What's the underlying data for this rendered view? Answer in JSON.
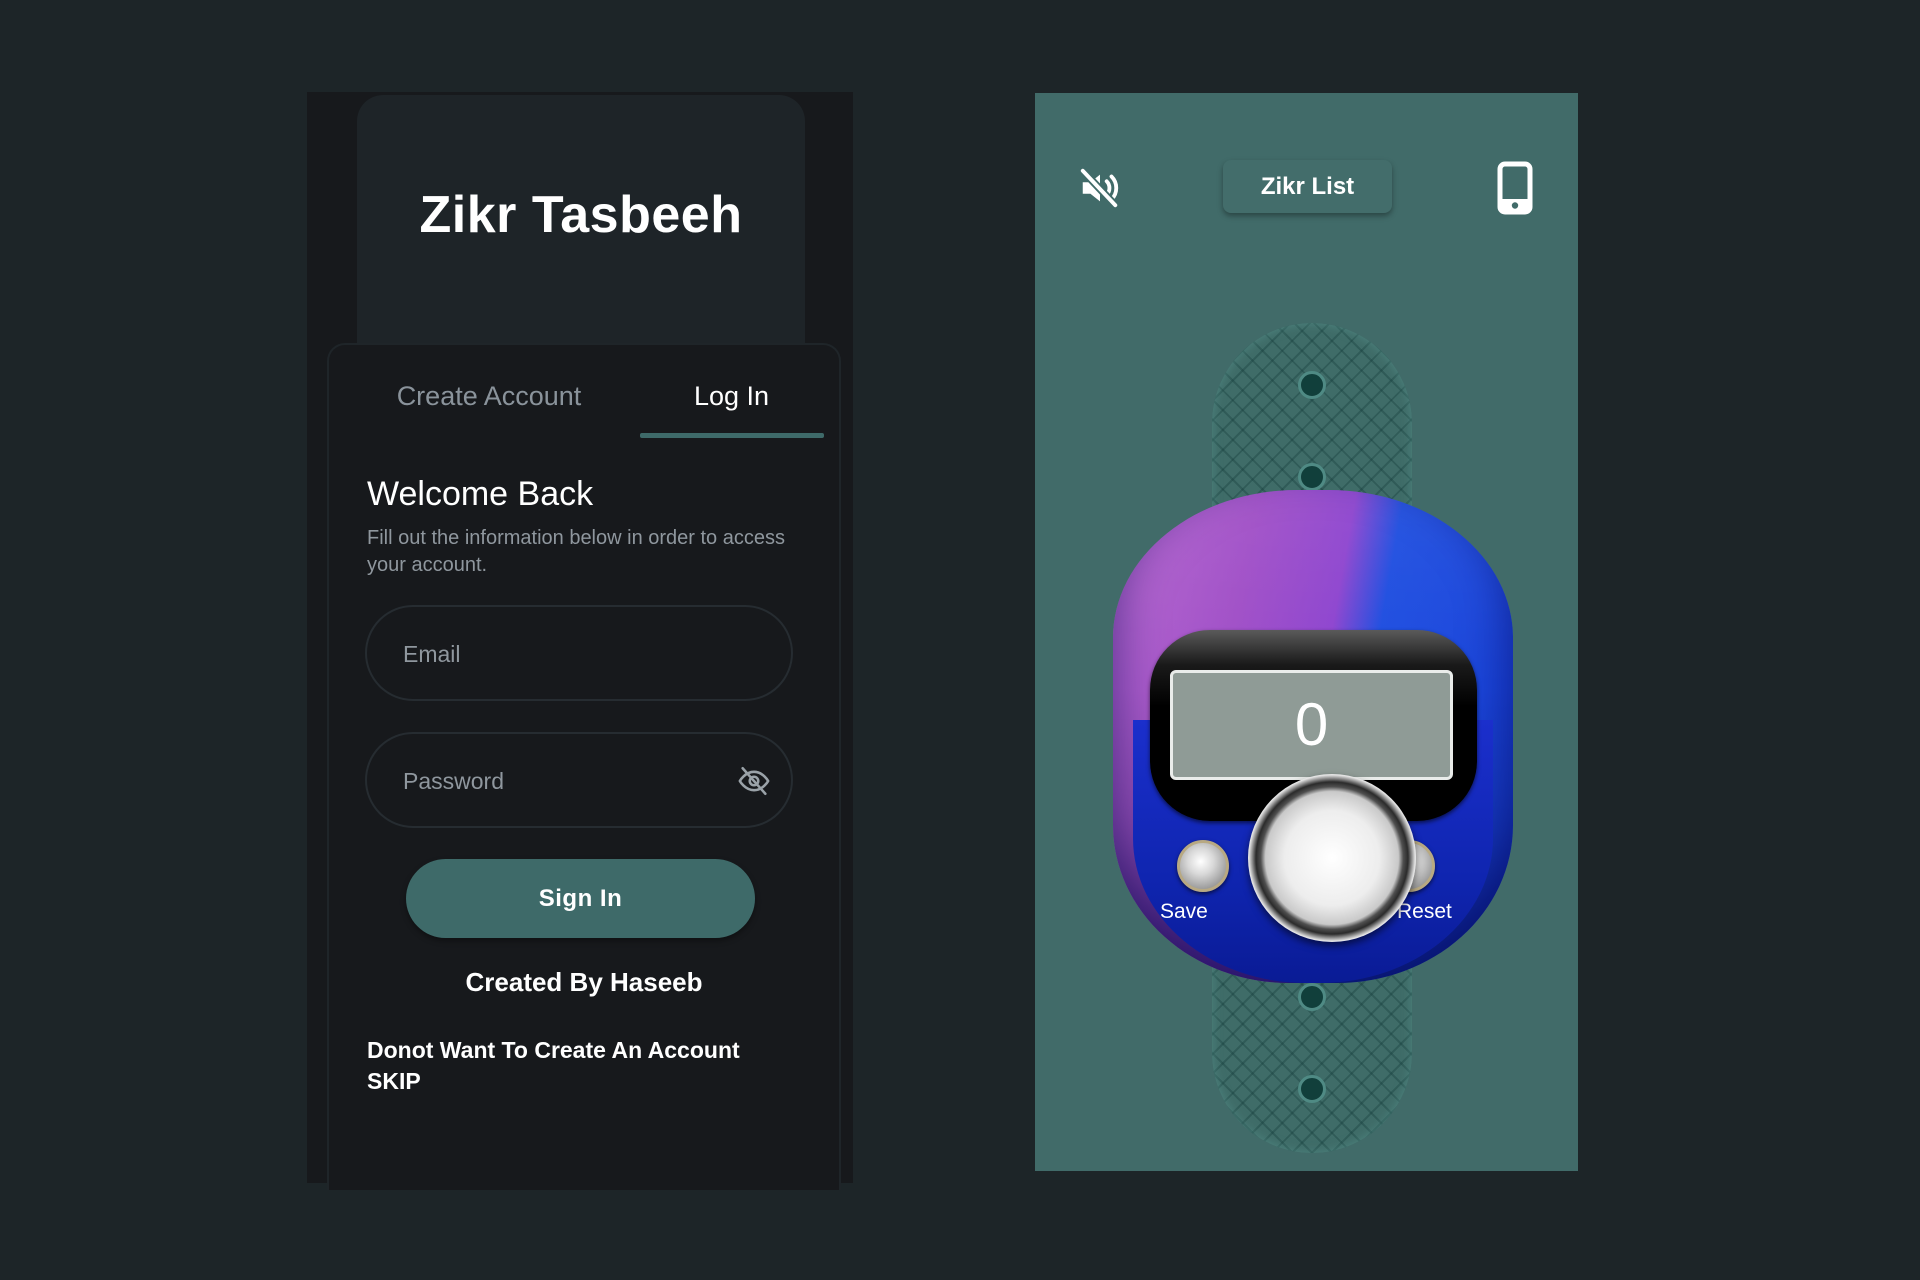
{
  "login_screen": {
    "app_title": "Zikr Tasbeeh",
    "tabs": [
      {
        "label": "Create Account",
        "active": false
      },
      {
        "label": "Log In",
        "active": true
      }
    ],
    "welcome_title": "Welcome Back",
    "welcome_subtitle": "Fill out the information below in order to access your account.",
    "email": {
      "placeholder": "Email",
      "value": ""
    },
    "password": {
      "placeholder": "Password",
      "value": "",
      "toggle_icon": "eye-off-icon"
    },
    "sign_in_label": "Sign In",
    "created_by": "Created By Haseeb",
    "skip_prompt": "Donot Want To Create An Account",
    "skip_label": "SKIP"
  },
  "counter_screen": {
    "mute_icon": "volume-off-icon",
    "zikr_list_label": "Zikr List",
    "phone_icon": "smartphone-icon",
    "count": "0",
    "save_label": "Save",
    "reset_label": "Reset"
  },
  "colors": {
    "background": "#1d2528",
    "login_surface": "#17191c",
    "header_card": "#1e2428",
    "accent_teal": "#3e6a69",
    "counter_background": "#416b69",
    "muted_text": "#8f979e"
  }
}
